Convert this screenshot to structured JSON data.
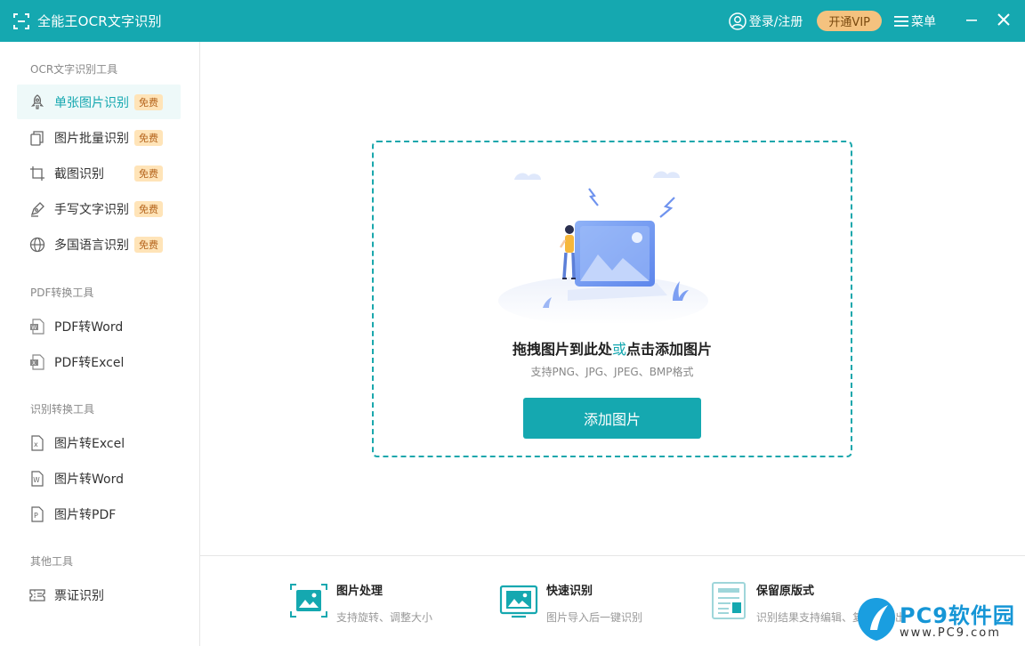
{
  "titlebar": {
    "app_title": "全能王OCR文字识别",
    "login_label": "登录/注册",
    "vip_label": "开通VIP",
    "menu_label": "菜单"
  },
  "sidebar": {
    "groups": [
      {
        "title": "OCR文字识别工具"
      },
      {
        "title": "PDF转换工具"
      },
      {
        "title": "识别转换工具"
      },
      {
        "title": "其他工具"
      }
    ],
    "items": [
      {
        "label": "单张图片识别",
        "badge": "免费",
        "icon": "rocket-icon",
        "active": true
      },
      {
        "label": "图片批量识别",
        "badge": "免费",
        "icon": "copy-icon"
      },
      {
        "label": "截图识别",
        "badge": "免费",
        "icon": "crop-icon"
      },
      {
        "label": "手写文字识别",
        "badge": "免费",
        "icon": "pen-icon"
      },
      {
        "label": "多国语言识别",
        "badge": "免费",
        "icon": "globe-icon"
      },
      {
        "label": "PDF转Word",
        "icon": "word-doc-icon"
      },
      {
        "label": "PDF转Excel",
        "icon": "excel-doc-icon"
      },
      {
        "label": "图片转Excel",
        "icon": "excel-file-icon"
      },
      {
        "label": "图片转Word",
        "icon": "word-file-icon"
      },
      {
        "label": "图片转PDF",
        "icon": "pdf-file-icon"
      },
      {
        "label": "票证识别",
        "icon": "ticket-icon"
      }
    ]
  },
  "dropzone": {
    "title_part1": "拖拽图片到此处",
    "title_or": "或",
    "title_part2": "点击添加图片",
    "subtitle": "支持PNG、JPG、JPEG、BMP格式",
    "button_label": "添加图片"
  },
  "features": [
    {
      "title": "图片处理",
      "desc": "支持旋转、调整大小",
      "icon": "image-edit-icon"
    },
    {
      "title": "快速识别",
      "desc": "图片导入后一键识别",
      "icon": "monitor-image-icon"
    },
    {
      "title": "保留原版式",
      "desc": "识别结果支持编辑、复制、导出",
      "icon": "layout-icon"
    }
  ],
  "watermark": {
    "brand": "PC9软件园",
    "url": "www.PC9.com"
  },
  "colors": {
    "accent": "#15a8b0",
    "vip": "#f4c27f",
    "badge_bg": "#ffe4b8"
  }
}
